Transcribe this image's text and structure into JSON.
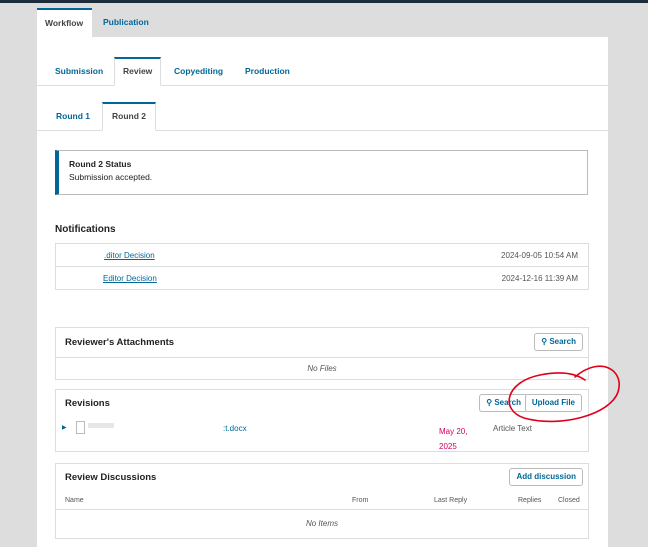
{
  "top_tabs": [
    "Workflow",
    "Publication"
  ],
  "stage_tabs": [
    "Submission",
    "Review",
    "Copyediting",
    "Production"
  ],
  "round_tabs": [
    "Round 1",
    "Round 2"
  ],
  "status": {
    "title": "Round 2 Status",
    "text": "Submission accepted."
  },
  "notifications": {
    "heading": "Notifications",
    "rows": [
      {
        "link": ".ditor Decision",
        "date": "2024-09-05 10:54 AM"
      },
      {
        "link": "Editor Decision",
        "date": "2024-12-16 11:39 AM"
      }
    ]
  },
  "reviewer_attachments": {
    "title": "Reviewer's Attachments",
    "search_label": "Search",
    "empty": "No Files"
  },
  "revisions": {
    "title": "Revisions",
    "search_label": "Search",
    "upload_label": "Upload File",
    "files": [
      {
        "name": ":t.docx",
        "date_line1": "May 20,",
        "date_line2": "2025",
        "type": "Article Text"
      }
    ]
  },
  "review_discussions": {
    "title": "Review Discussions",
    "add_label": "Add discussion",
    "columns": [
      "Name",
      "From",
      "Last Reply",
      "Replies",
      "Closed"
    ],
    "empty": "No Items"
  },
  "colors": {
    "accent": "#006798",
    "annotation": "#e0001b",
    "date": "#d00060"
  }
}
